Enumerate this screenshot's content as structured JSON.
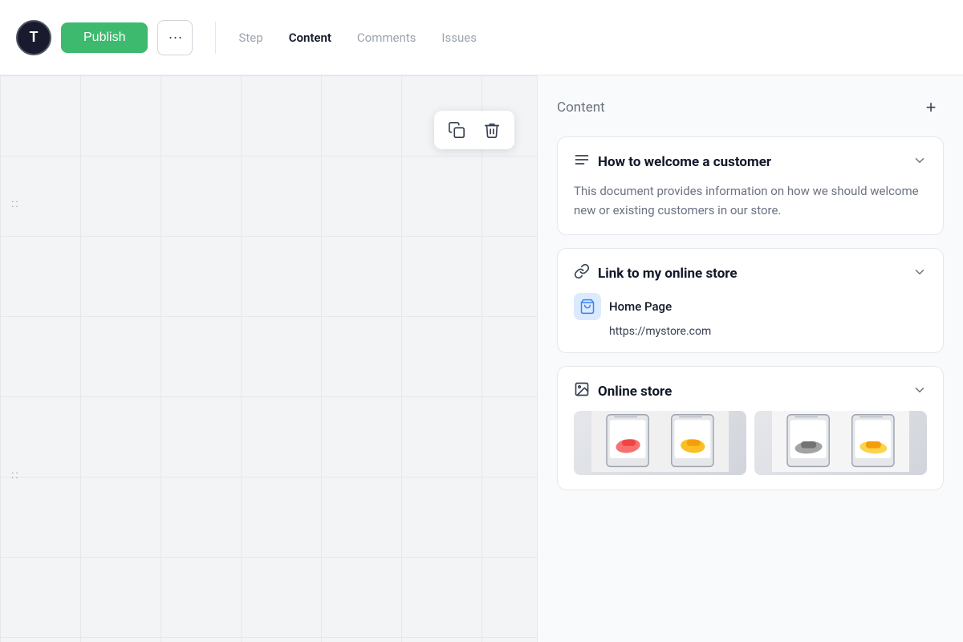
{
  "header": {
    "avatar_letter": "T",
    "publish_label": "Publish",
    "more_dots": "···",
    "nav": {
      "step": "Step",
      "content": "Content",
      "comments": "Comments",
      "issues": "Issues"
    }
  },
  "canvas": {
    "toolbar": {
      "copy_icon": "⧉",
      "delete_icon": "🗑"
    },
    "drag_handle": "::"
  },
  "right_panel": {
    "title": "Content",
    "add_icon": "+",
    "cards": [
      {
        "id": "doc-card",
        "icon": "≡",
        "title": "How to welcome a customer",
        "chevron": "∨",
        "body": "This document provides information on how we should welcome new or existing customers in our store."
      },
      {
        "id": "link-card",
        "icon": "🔗",
        "title": "Link to my online store",
        "chevron": "∨",
        "link_label": "Home Page",
        "link_url": "https://mystore.com"
      },
      {
        "id": "store-card",
        "icon": "⊡",
        "title": "Online store",
        "chevron": "∨"
      }
    ]
  }
}
